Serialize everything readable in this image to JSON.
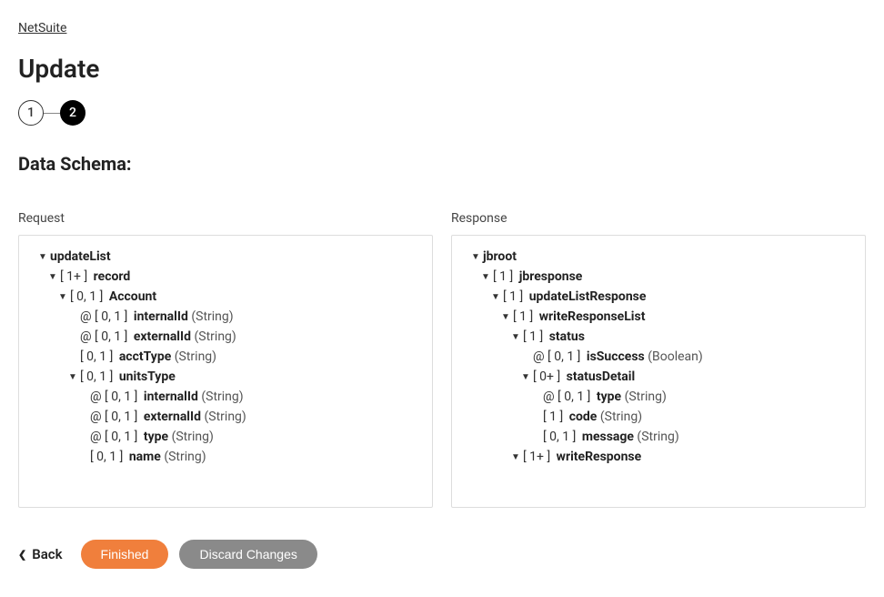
{
  "breadcrumb": "NetSuite",
  "page_title": "Update",
  "stepper": {
    "step1": "1",
    "step2": "2"
  },
  "section_title": "Data Schema:",
  "request_label": "Request",
  "response_label": "Response",
  "request_tree": [
    {
      "indent": 0,
      "chevron": true,
      "prefix": "",
      "card": "",
      "name": "updateList",
      "type": ""
    },
    {
      "indent": 1,
      "chevron": true,
      "prefix": "",
      "card": "[ 1+ ]",
      "name": "record",
      "type": ""
    },
    {
      "indent": 2,
      "chevron": true,
      "prefix": "",
      "card": "[ 0, 1 ]",
      "name": "Account",
      "type": ""
    },
    {
      "indent": 3,
      "chevron": false,
      "prefix": "@",
      "card": "[ 0, 1 ]",
      "name": "internalId",
      "type": "(String)"
    },
    {
      "indent": 3,
      "chevron": false,
      "prefix": "@",
      "card": "[ 0, 1 ]",
      "name": "externalId",
      "type": "(String)"
    },
    {
      "indent": 3,
      "chevron": false,
      "prefix": "",
      "card": "[ 0, 1 ]",
      "name": "acctType",
      "type": "(String)"
    },
    {
      "indent": 3,
      "chevron": true,
      "prefix": "",
      "card": "[ 0, 1 ]",
      "name": "unitsType",
      "type": ""
    },
    {
      "indent": 4,
      "chevron": false,
      "prefix": "@",
      "card": "[ 0, 1 ]",
      "name": "internalId",
      "type": "(String)"
    },
    {
      "indent": 4,
      "chevron": false,
      "prefix": "@",
      "card": "[ 0, 1 ]",
      "name": "externalId",
      "type": "(String)"
    },
    {
      "indent": 4,
      "chevron": false,
      "prefix": "@",
      "card": "[ 0, 1 ]",
      "name": "type",
      "type": "(String)"
    },
    {
      "indent": 4,
      "chevron": false,
      "prefix": "",
      "card": "[ 0, 1 ]",
      "name": "name",
      "type": "(String)"
    }
  ],
  "response_tree": [
    {
      "indent": 0,
      "chevron": true,
      "prefix": "",
      "card": "",
      "name": "jbroot",
      "type": ""
    },
    {
      "indent": 1,
      "chevron": true,
      "prefix": "",
      "card": "[ 1 ]",
      "name": "jbresponse",
      "type": ""
    },
    {
      "indent": 2,
      "chevron": true,
      "prefix": "",
      "card": "[ 1 ]",
      "name": "updateListResponse",
      "type": ""
    },
    {
      "indent": 3,
      "chevron": true,
      "prefix": "",
      "card": "[ 1 ]",
      "name": "writeResponseList",
      "type": ""
    },
    {
      "indent": 4,
      "chevron": true,
      "prefix": "",
      "card": "[ 1 ]",
      "name": "status",
      "type": ""
    },
    {
      "indent": 5,
      "chevron": false,
      "prefix": "@",
      "card": "[ 0, 1 ]",
      "name": "isSuccess",
      "type": "(Boolean)"
    },
    {
      "indent": 5,
      "chevron": true,
      "prefix": "",
      "card": "[ 0+ ]",
      "name": "statusDetail",
      "type": ""
    },
    {
      "indent": 6,
      "chevron": false,
      "prefix": "@",
      "card": "[ 0, 1 ]",
      "name": "type",
      "type": "(String)"
    },
    {
      "indent": 6,
      "chevron": false,
      "prefix": "",
      "card": "[ 1 ]",
      "name": "code",
      "type": "(String)"
    },
    {
      "indent": 6,
      "chevron": false,
      "prefix": "",
      "card": "[ 0, 1 ]",
      "name": "message",
      "type": "(String)"
    },
    {
      "indent": 4,
      "chevron": true,
      "prefix": "",
      "card": "[ 1+ ]",
      "name": "writeResponse",
      "type": ""
    }
  ],
  "footer": {
    "back": "Back",
    "finished": "Finished",
    "discard": "Discard Changes"
  }
}
